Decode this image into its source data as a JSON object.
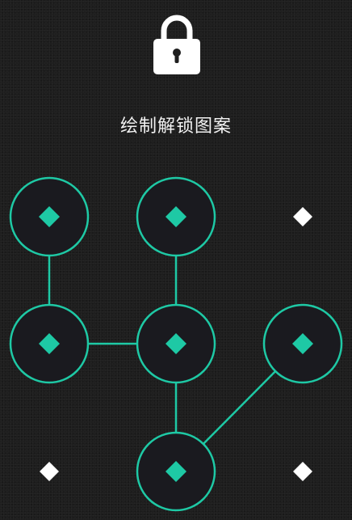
{
  "prompt": "绘制解锁图案",
  "icons": {
    "lock": "lock-icon",
    "node_marker": "diamond"
  },
  "colors": {
    "background": "#1e1e1e",
    "accent": "#1ec9a5",
    "node_fill": "#1a1a1f",
    "dot": "#ffffff",
    "text": "#f2f2f2"
  },
  "pattern": {
    "grid": 3,
    "selected_nodes": [
      1,
      2,
      4,
      5,
      6,
      8
    ],
    "connections": [
      [
        1,
        4
      ],
      [
        2,
        5
      ],
      [
        4,
        5
      ],
      [
        5,
        8
      ],
      [
        8,
        6
      ]
    ]
  }
}
